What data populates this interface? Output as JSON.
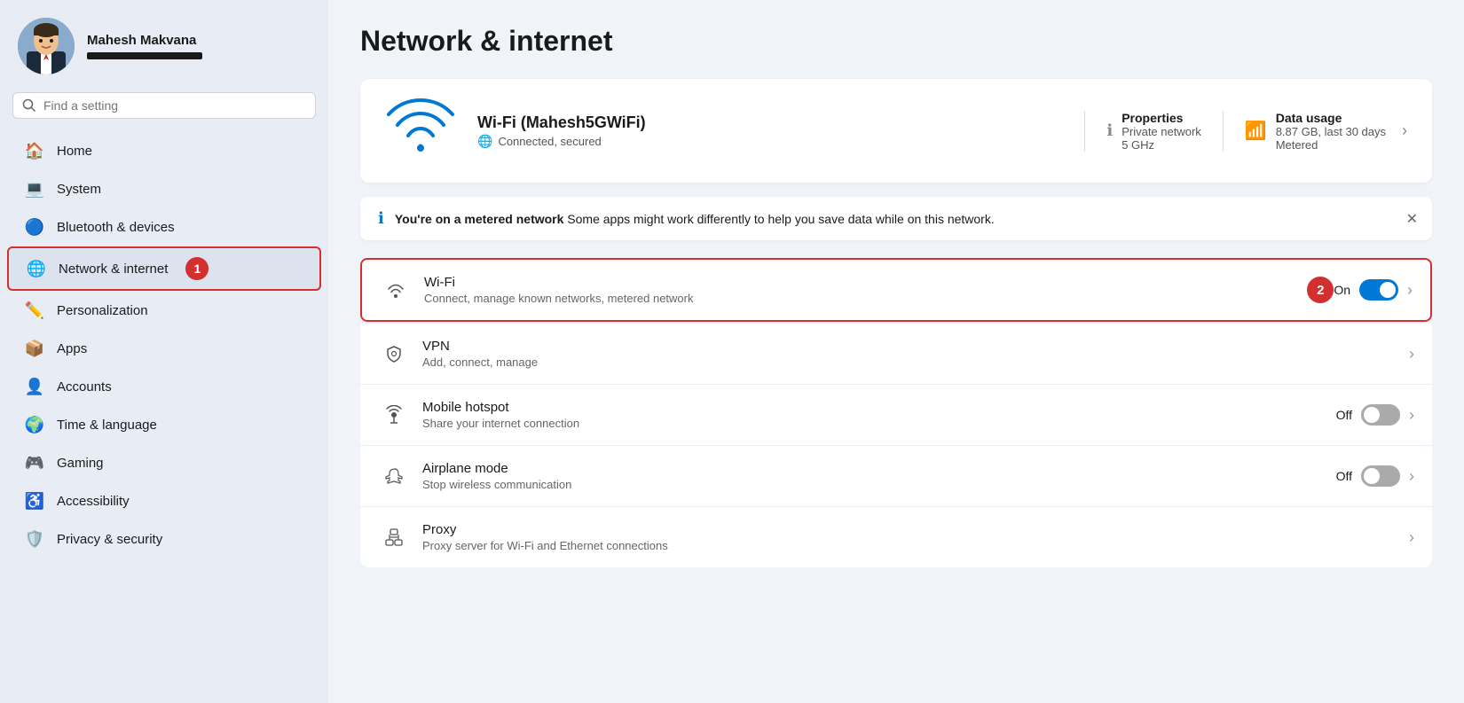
{
  "user": {
    "name": "Mahesh Makvana"
  },
  "search": {
    "placeholder": "Find a setting"
  },
  "sidebar": {
    "items": [
      {
        "id": "home",
        "label": "Home",
        "icon": "🏠"
      },
      {
        "id": "system",
        "label": "System",
        "icon": "💻"
      },
      {
        "id": "bluetooth",
        "label": "Bluetooth & devices",
        "icon": "🔵"
      },
      {
        "id": "network",
        "label": "Network & internet",
        "icon": "🌐",
        "active": true
      },
      {
        "id": "personalization",
        "label": "Personalization",
        "icon": "✏️"
      },
      {
        "id": "apps",
        "label": "Apps",
        "icon": "📦"
      },
      {
        "id": "accounts",
        "label": "Accounts",
        "icon": "👤"
      },
      {
        "id": "time",
        "label": "Time & language",
        "icon": "🌍"
      },
      {
        "id": "gaming",
        "label": "Gaming",
        "icon": "🎮"
      },
      {
        "id": "accessibility",
        "label": "Accessibility",
        "icon": "♿"
      },
      {
        "id": "privacy",
        "label": "Privacy & security",
        "icon": "🛡️"
      }
    ]
  },
  "page": {
    "title": "Network & internet"
  },
  "wifi_card": {
    "name": "Wi-Fi (Mahesh5GWiFi)",
    "status": "Connected, secured",
    "properties_label": "Properties",
    "properties_sub1": "Private network",
    "properties_sub2": "5 GHz",
    "data_usage_label": "Data usage",
    "data_usage_sub1": "8.87 GB, last 30 days",
    "data_usage_sub2": "Metered"
  },
  "banner": {
    "bold": "You're on a metered network",
    "text": "  Some apps might work differently to help you save data while on this network."
  },
  "settings": [
    {
      "id": "wifi",
      "title": "Wi-Fi",
      "subtitle": "Connect, manage known networks, metered network",
      "has_toggle": true,
      "toggle_state": "on",
      "toggle_label": "On",
      "has_chevron": true,
      "highlighted": true,
      "step": "2"
    },
    {
      "id": "vpn",
      "title": "VPN",
      "subtitle": "Add, connect, manage",
      "has_toggle": false,
      "has_chevron": true,
      "highlighted": false
    },
    {
      "id": "hotspot",
      "title": "Mobile hotspot",
      "subtitle": "Share your internet connection",
      "has_toggle": true,
      "toggle_state": "off",
      "toggle_label": "Off",
      "has_chevron": true,
      "highlighted": false
    },
    {
      "id": "airplane",
      "title": "Airplane mode",
      "subtitle": "Stop wireless communication",
      "has_toggle": true,
      "toggle_state": "off",
      "toggle_label": "Off",
      "has_chevron": true,
      "highlighted": false
    },
    {
      "id": "proxy",
      "title": "Proxy",
      "subtitle": "Proxy server for Wi-Fi and Ethernet connections",
      "has_toggle": false,
      "has_chevron": true,
      "highlighted": false
    }
  ],
  "icons": {
    "wifi_large": "wifi-large-icon",
    "properties": "info-circle-icon",
    "data_usage": "data-usage-icon",
    "wifi_item": "wifi-item-icon",
    "vpn": "vpn-icon",
    "hotspot": "hotspot-icon",
    "airplane": "airplane-icon",
    "proxy": "proxy-icon"
  },
  "badges": {
    "sidebar_step": "1",
    "wifi_step": "2"
  }
}
